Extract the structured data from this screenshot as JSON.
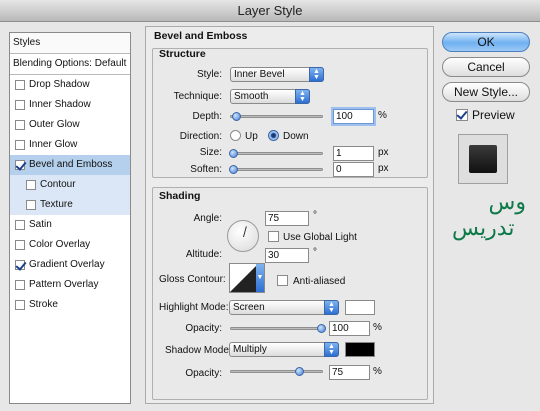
{
  "window": {
    "title": "Layer Style"
  },
  "styles_panel": {
    "header": "Styles",
    "blending_options": "Blending Options: Default",
    "items": [
      {
        "label": "Drop Shadow",
        "checked": false
      },
      {
        "label": "Inner Shadow",
        "checked": false
      },
      {
        "label": "Outer Glow",
        "checked": false
      },
      {
        "label": "Inner Glow",
        "checked": false
      },
      {
        "label": "Bevel and Emboss",
        "checked": true,
        "selected": true
      },
      {
        "label": "Contour",
        "checked": false,
        "sub": true
      },
      {
        "label": "Texture",
        "checked": false,
        "sub": true
      },
      {
        "label": "Satin",
        "checked": false
      },
      {
        "label": "Color Overlay",
        "checked": false
      },
      {
        "label": "Gradient Overlay",
        "checked": true
      },
      {
        "label": "Pattern Overlay",
        "checked": false
      },
      {
        "label": "Stroke",
        "checked": false
      }
    ]
  },
  "bevel": {
    "title": "Bevel and Emboss",
    "structure": {
      "title": "Structure",
      "style_label": "Style:",
      "style_value": "Inner Bevel",
      "technique_label": "Technique:",
      "technique_value": "Smooth",
      "depth_label": "Depth:",
      "depth_value": "100",
      "depth_unit": "%",
      "direction_label": "Direction:",
      "direction_up": "Up",
      "direction_down": "Down",
      "size_label": "Size:",
      "size_value": "1",
      "size_unit": "px",
      "soften_label": "Soften:",
      "soften_value": "0",
      "soften_unit": "px"
    },
    "shading": {
      "title": "Shading",
      "angle_label": "Angle:",
      "angle_value": "75",
      "angle_unit": "°",
      "global_light_label": "Use Global Light",
      "altitude_label": "Altitude:",
      "altitude_value": "30",
      "altitude_unit": "°",
      "gloss_label": "Gloss Contour:",
      "anti_aliased_label": "Anti-aliased",
      "highlight_mode_label": "Highlight Mode:",
      "highlight_mode_value": "Screen",
      "highlight_color": "#ffffff",
      "highlight_opacity_label": "Opacity:",
      "highlight_opacity_value": "100",
      "highlight_opacity_unit": "%",
      "shadow_mode_label": "Shadow Mode:",
      "shadow_mode_value": "Multiply",
      "shadow_color": "#000000",
      "shadow_opacity_label": "Opacity:",
      "shadow_opacity_value": "75",
      "shadow_opacity_unit": "%"
    }
  },
  "buttons": {
    "ok": "OK",
    "cancel": "Cancel",
    "new_style": "New Style...",
    "preview": "Preview"
  },
  "watermark": {
    "line1": "وس",
    "line2": "تدریس"
  }
}
